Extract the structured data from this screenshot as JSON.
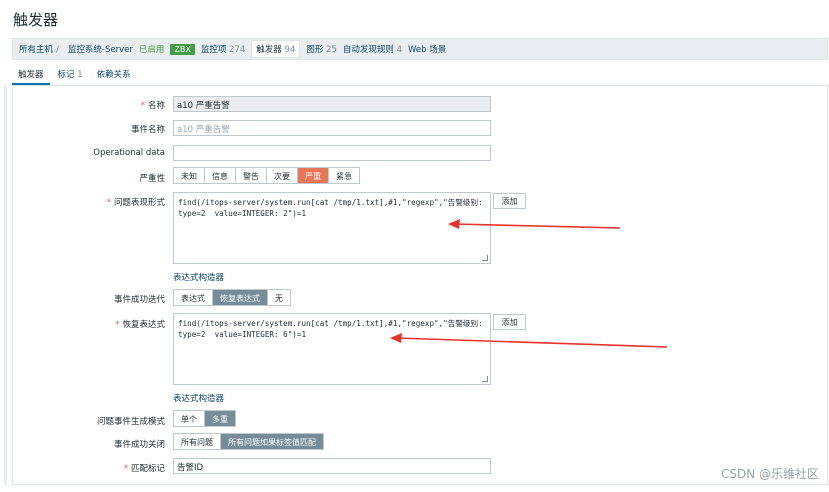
{
  "page": {
    "title": "触发器"
  },
  "breadcrumb": {
    "all_hosts": "所有主机",
    "host": "监控系统-Server",
    "status": "已启用",
    "zbx": "ZBX",
    "items_label": "监控项",
    "items_count": "274",
    "triggers_label": "触发器",
    "triggers_count": "94",
    "graphs_label": "图形",
    "graphs_count": "25",
    "discovery_label": "自动发现规则",
    "discovery_count": "4",
    "web_label": "Web 场景"
  },
  "tabs": {
    "trigger": "触发器",
    "tags_label": "标记",
    "tags_count": "1",
    "dependencies": "依赖关系"
  },
  "form": {
    "name_label": "名称",
    "name_value": "a10 严重告警",
    "event_name_label": "事件名称",
    "event_name_placeholder": "a10 严重告警",
    "opdata_label": "Operational data",
    "opdata_value": "",
    "severity_label": "严重性",
    "severity_options": [
      "未知",
      "信息",
      "警告",
      "次要",
      "严重",
      "紧急"
    ],
    "severity_selected": "严重",
    "problem_expr_label": "问题表现形式",
    "problem_expr_value": "find(/itops-server/system.run[cat /tmp/1.txt],#1,\"regexp\",\"告警级别: type=2  value=INTEGER: 2\")=1",
    "add_button": "添加",
    "expr_builder_link": "表达式构造器",
    "ok_event_gen_label": "事件成功迭代",
    "ok_event_gen_options": [
      "表达式",
      "恢复表达式",
      "无"
    ],
    "ok_event_gen_selected": "恢复表达式",
    "recovery_expr_label": "恢复表达式",
    "recovery_expr_value": "find(/itops-server/system.run[cat /tmp/1.txt],#1,\"regexp\",\"告警级别: type=2  value=INTEGER: 6\")=1",
    "add_button_2": "添加",
    "expr_builder_link_2": "表达式构造器",
    "problem_mode_label": "问题事件生成模式",
    "problem_mode_options": [
      "单个",
      "多重"
    ],
    "problem_mode_selected": "多重",
    "ok_close_label": "事件成功关闭",
    "ok_close_options": [
      "所有问题",
      "所有问题如果标签值匹配"
    ],
    "ok_close_selected": "所有问题如果标签值匹配",
    "tag_match_label": "匹配标记",
    "tag_match_value": "告警ID"
  },
  "watermark": "CSDN @乐维社区",
  "colors": {
    "accent": "#0275b8",
    "severity_high": "#e97659",
    "selected_segment": "#768d99",
    "arrow": "#e8332a"
  }
}
